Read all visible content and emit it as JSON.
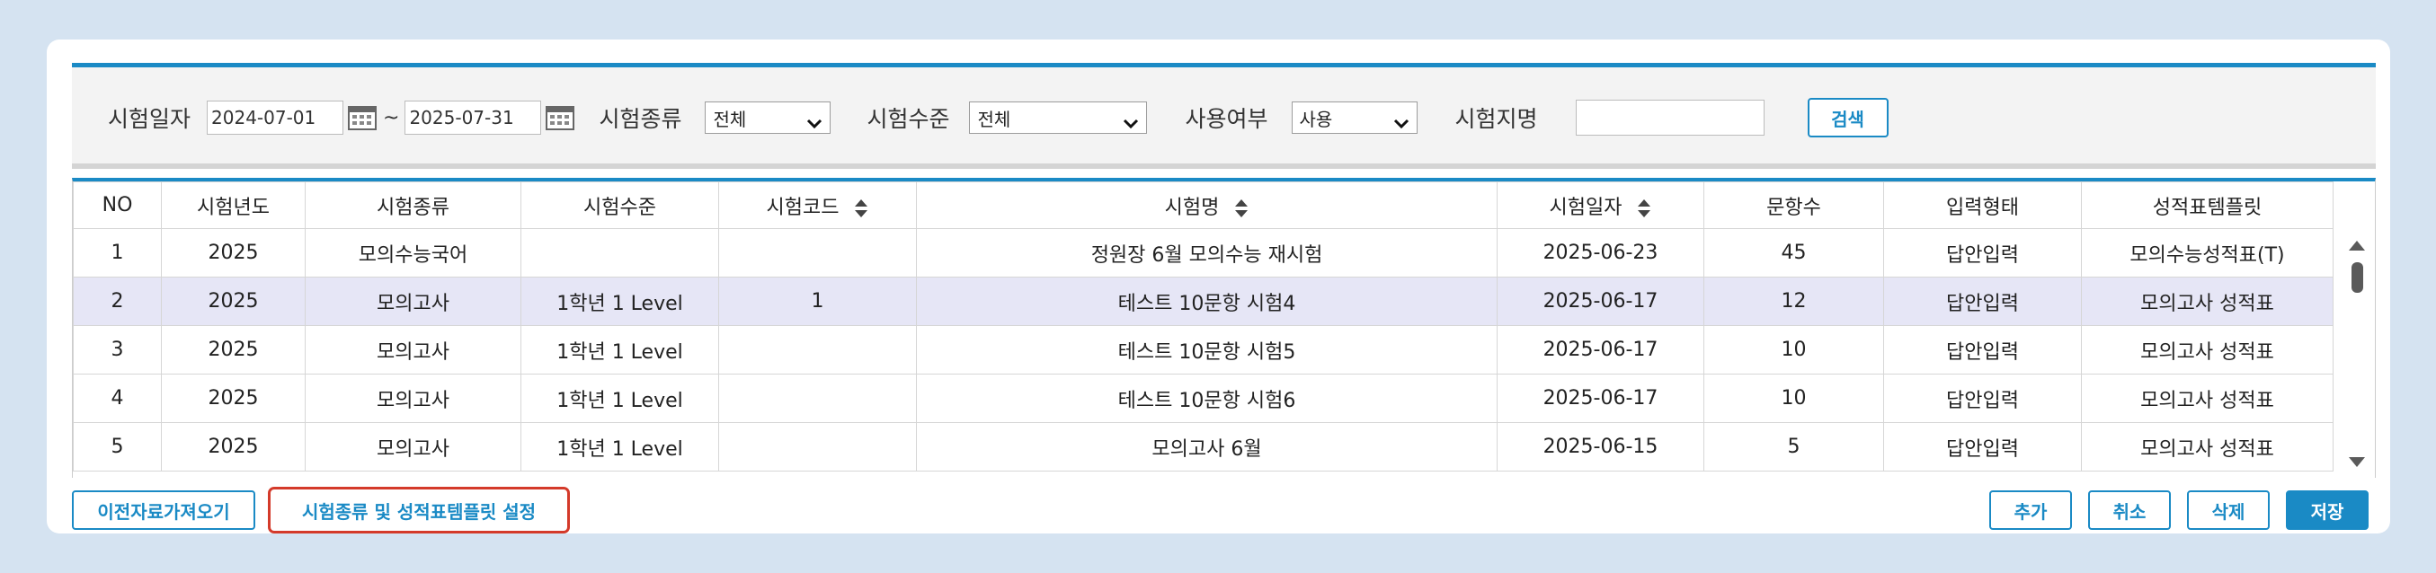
{
  "search": {
    "exam_date_label": "시험일자",
    "date_from": "2024-07-01",
    "date_sep": "~",
    "date_to": "2025-07-31",
    "exam_type_label": "시험종류",
    "exam_type_value": "전체",
    "exam_level_label": "시험수준",
    "exam_level_value": "전체",
    "use_label": "사용여부",
    "use_value": "사용",
    "exam_name_label": "시험지명",
    "exam_name_value": "",
    "search_button": "검색"
  },
  "grid": {
    "columns": [
      "NO",
      "시험년도",
      "시험종류",
      "시험수준",
      "시험코드",
      "시험명",
      "시험일자",
      "문항수",
      "입력형태",
      "성적표템플릿"
    ],
    "rows": [
      [
        "1",
        "2025",
        "모의수능국어",
        "",
        "",
        "정원장 6월 모의수능 재시험",
        "2025-06-23",
        "45",
        "답안입력",
        "모의수능성적표(T)"
      ],
      [
        "2",
        "2025",
        "모의고사",
        "1학년 1 Level",
        "1",
        "테스트 10문항 시험4",
        "2025-06-17",
        "12",
        "답안입력",
        "모의고사 성적표"
      ],
      [
        "3",
        "2025",
        "모의고사",
        "1학년 1 Level",
        "",
        "테스트 10문항 시험5",
        "2025-06-17",
        "10",
        "답안입력",
        "모의고사 성적표"
      ],
      [
        "4",
        "2025",
        "모의고사",
        "1학년 1 Level",
        "",
        "테스트 10문항 시험6",
        "2025-06-17",
        "10",
        "답안입력",
        "모의고사 성적표"
      ],
      [
        "5",
        "2025",
        "모의고사",
        "1학년 1 Level",
        "",
        "모의고사 6월",
        "2025-06-15",
        "5",
        "답안입력",
        "모의고사 성적표"
      ]
    ],
    "selected_row": 1
  },
  "footer": {
    "import_button": "이전자료가져오기",
    "settings_button": "시험종류 및 성적표템플릿 설정",
    "add_button": "추가",
    "cancel_button": "취소",
    "delete_button": "삭제",
    "save_button": "저장"
  },
  "colors": {
    "accent": "#1a8ac5",
    "highlight_border": "#d43a2a",
    "selected_row_bg": "#e6e6f6",
    "page_bg": "#d5e3f1"
  }
}
